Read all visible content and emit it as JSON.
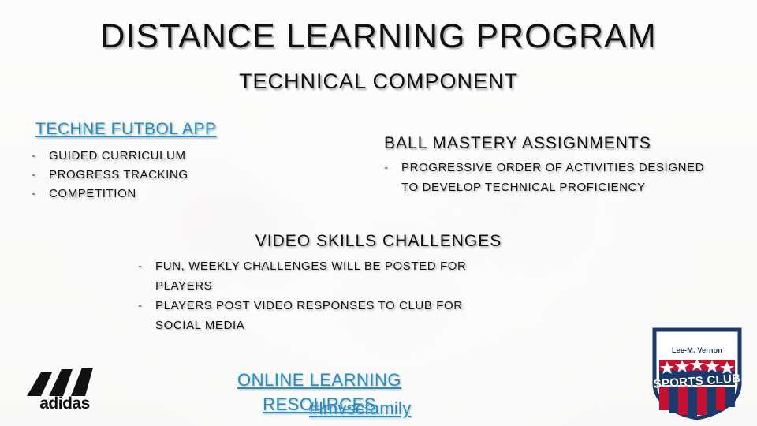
{
  "slide": {
    "title": "DISTANCE LEARNING PROGRAM",
    "subtitle": "TECHNICAL COMPONENT",
    "accent_color": "#1e90c8",
    "text_color": "#111111",
    "sections": {
      "app": {
        "heading": "TECHNE FUTBOL APP",
        "bullets": [
          "GUIDED CURRICULUM",
          "PROGRESS TRACKING",
          "COMPETITION"
        ]
      },
      "ball_mastery": {
        "heading": "BALL MASTERY ASSIGNMENTS",
        "bullets": [
          "PROGRESSIVE ORDER OF ACTIVITIES DESIGNED TO DEVELOP TECHNICAL PROFICIENCY"
        ]
      },
      "video_skills": {
        "heading": "VIDEO SKILLS CHALLENGES",
        "bullets": [
          "FUN, WEEKLY CHALLENGES WILL BE POSTED FOR PLAYERS",
          "PLAYERS POST VIDEO RESPONSES TO CLUB FOR SOCIAL MEDIA"
        ]
      },
      "online": {
        "link_text": "ONLINE LEARNING RESOURCES",
        "hashtag": "#lmvscfamily"
      }
    },
    "bullet_marker": "-",
    "logos": {
      "adidas": {
        "wordmark": "adidas",
        "icon": "adidas-three-bars-icon"
      },
      "club": {
        "top_text": "Lee-M. Vernon",
        "main_text": "SPORTS CLUB",
        "icon": "club-crest-icon"
      }
    }
  }
}
